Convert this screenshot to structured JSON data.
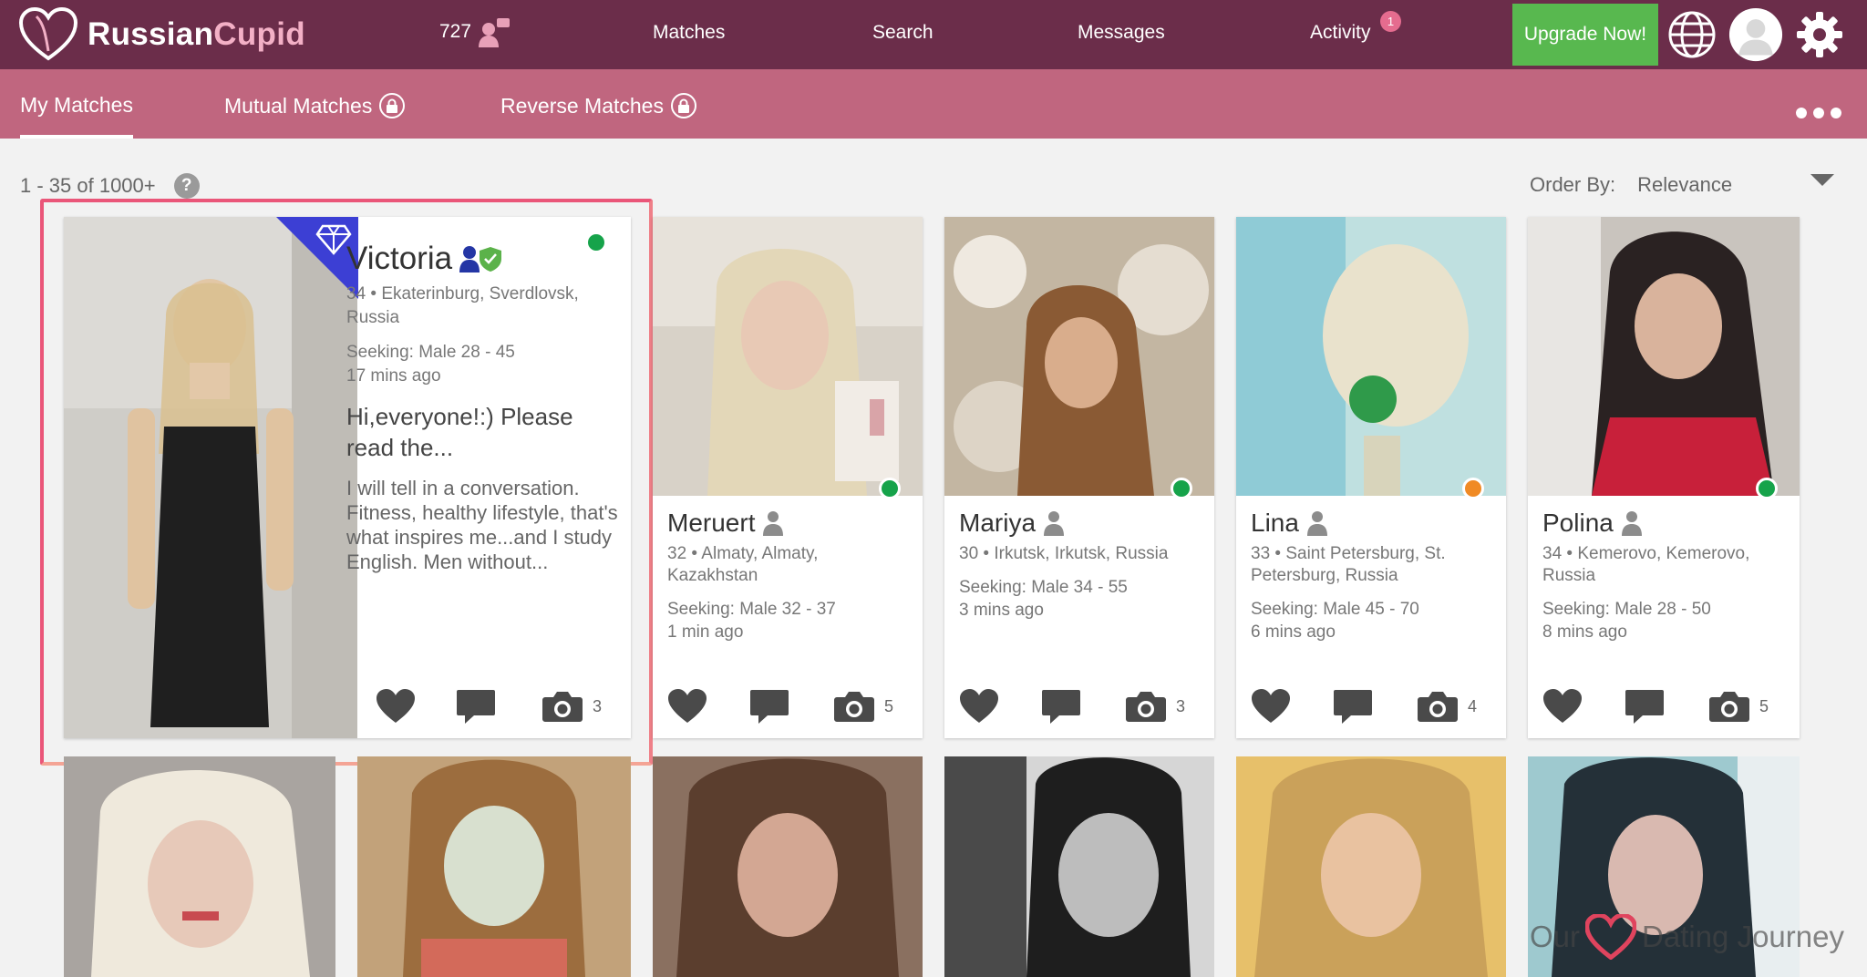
{
  "brand": {
    "name_part1": "Russian",
    "name_part2": "Cupid"
  },
  "header": {
    "counter": "727",
    "nav": [
      "Matches",
      "Search",
      "Messages",
      "Activity"
    ],
    "activity_badge": "1",
    "upgrade_label": "Upgrade Now!"
  },
  "subnav": {
    "tabs": [
      "My Matches",
      "Mutual Matches",
      "Reverse Matches"
    ],
    "active_tab": "My Matches"
  },
  "results": {
    "count": "1 - 35 of 1000+",
    "help": "?",
    "order_label": "Order By:",
    "order_value": "Relevance"
  },
  "featured": {
    "name": "Victoria",
    "location": "34 • Ekaterinburg, Sverdlovsk, Russia",
    "seeking": "Seeking: Male 28 - 45",
    "last_active": "17 mins ago",
    "headline": "Hi,everyone!:) Please read the...",
    "about": "I will tell in a conversation. Fitness, healthy lifestyle, that's what inspires me...and I study English. Men without...",
    "photos": "3",
    "online": true
  },
  "cards": [
    {
      "name": "Meruert",
      "location": "32 • Almaty, Almaty, Kazakhstan",
      "seeking": "Seeking: Male 32 - 37",
      "last_active": "1 min ago",
      "photos": "5",
      "status": "online"
    },
    {
      "name": "Mariya",
      "location": "30 • Irkutsk, Irkutsk, Russia",
      "seeking": "Seeking: Male 34 - 55",
      "last_active": "3 mins ago",
      "photos": "3",
      "status": "online"
    },
    {
      "name": "Lina",
      "location": "33 • Saint Petersburg, St. Petersburg, Russia",
      "seeking": "Seeking: Male 45 - 70",
      "last_active": "6 mins ago",
      "photos": "4",
      "status": "away"
    },
    {
      "name": "Polina",
      "location": "34 • Kemerovo, Kemerovo, Russia",
      "seeking": "Seeking: Male 28 - 50",
      "last_active": "8 mins ago",
      "photos": "5",
      "status": "online"
    }
  ],
  "watermark": {
    "part1": "Our",
    "part2": "Dating Journey"
  },
  "colors": {
    "header": "#6b2d4a",
    "subnav": "#c0667f",
    "upgrade": "#58b84f",
    "online": "#16a34a",
    "away": "#f08a24",
    "frame": "#ea5679"
  }
}
